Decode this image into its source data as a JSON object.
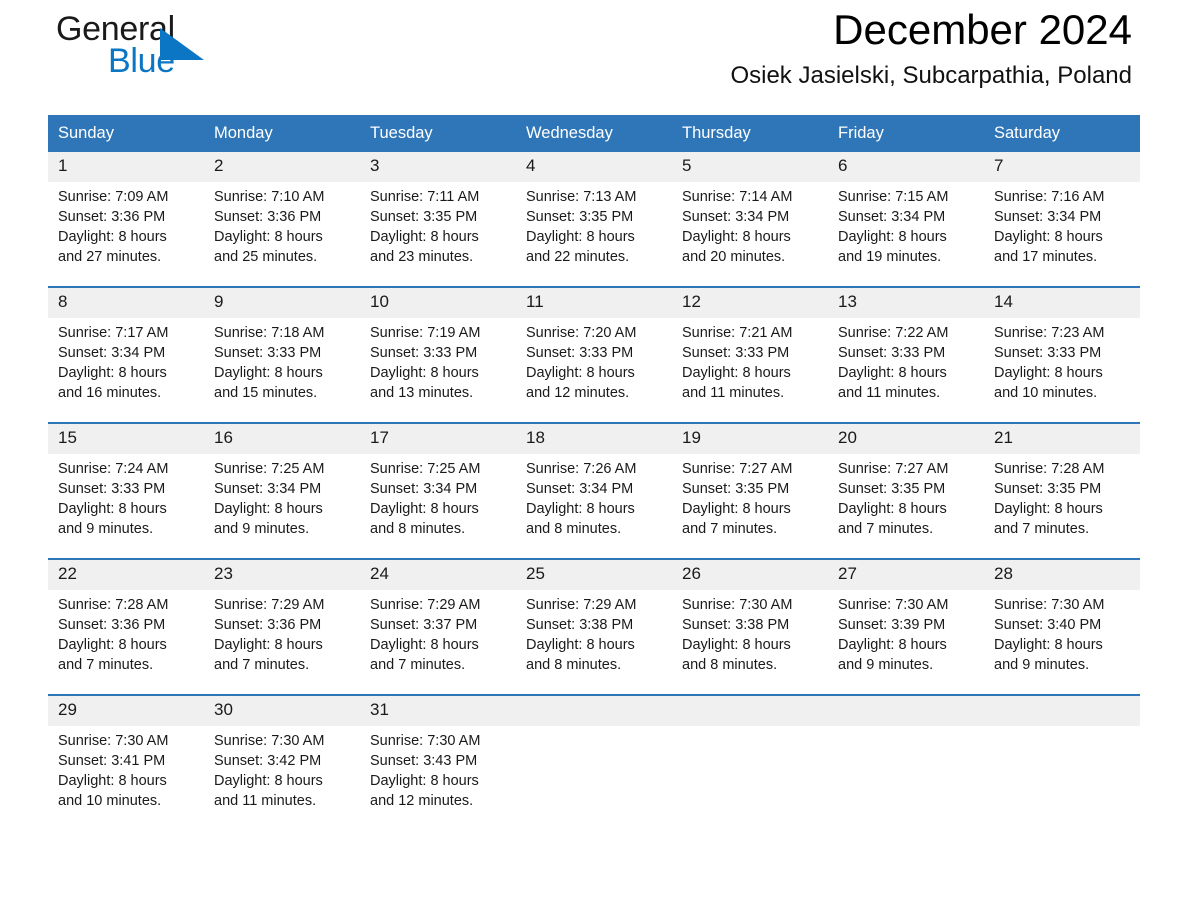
{
  "brand": {
    "name_part1": "General",
    "name_part2": "Blue",
    "flag_icon": "blue-triangle-flag-icon",
    "accent_color": "#0a76c4"
  },
  "header": {
    "title": "December 2024",
    "location": "Osiek Jasielski, Subcarpathia, Poland"
  },
  "theme": {
    "header_blue": "#2f76b8",
    "daynum_band": "#f0f0f0",
    "page_background": "#ffffff"
  },
  "calendar": {
    "weekday_headers": [
      "Sunday",
      "Monday",
      "Tuesday",
      "Wednesday",
      "Thursday",
      "Friday",
      "Saturday"
    ],
    "weeks": [
      [
        {
          "day": "1",
          "sunrise": "Sunrise: 7:09 AM",
          "sunset": "Sunset: 3:36 PM",
          "daylight1": "Daylight: 8 hours",
          "daylight2": "and 27 minutes."
        },
        {
          "day": "2",
          "sunrise": "Sunrise: 7:10 AM",
          "sunset": "Sunset: 3:36 PM",
          "daylight1": "Daylight: 8 hours",
          "daylight2": "and 25 minutes."
        },
        {
          "day": "3",
          "sunrise": "Sunrise: 7:11 AM",
          "sunset": "Sunset: 3:35 PM",
          "daylight1": "Daylight: 8 hours",
          "daylight2": "and 23 minutes."
        },
        {
          "day": "4",
          "sunrise": "Sunrise: 7:13 AM",
          "sunset": "Sunset: 3:35 PM",
          "daylight1": "Daylight: 8 hours",
          "daylight2": "and 22 minutes."
        },
        {
          "day": "5",
          "sunrise": "Sunrise: 7:14 AM",
          "sunset": "Sunset: 3:34 PM",
          "daylight1": "Daylight: 8 hours",
          "daylight2": "and 20 minutes."
        },
        {
          "day": "6",
          "sunrise": "Sunrise: 7:15 AM",
          "sunset": "Sunset: 3:34 PM",
          "daylight1": "Daylight: 8 hours",
          "daylight2": "and 19 minutes."
        },
        {
          "day": "7",
          "sunrise": "Sunrise: 7:16 AM",
          "sunset": "Sunset: 3:34 PM",
          "daylight1": "Daylight: 8 hours",
          "daylight2": "and 17 minutes."
        }
      ],
      [
        {
          "day": "8",
          "sunrise": "Sunrise: 7:17 AM",
          "sunset": "Sunset: 3:34 PM",
          "daylight1": "Daylight: 8 hours",
          "daylight2": "and 16 minutes."
        },
        {
          "day": "9",
          "sunrise": "Sunrise: 7:18 AM",
          "sunset": "Sunset: 3:33 PM",
          "daylight1": "Daylight: 8 hours",
          "daylight2": "and 15 minutes."
        },
        {
          "day": "10",
          "sunrise": "Sunrise: 7:19 AM",
          "sunset": "Sunset: 3:33 PM",
          "daylight1": "Daylight: 8 hours",
          "daylight2": "and 13 minutes."
        },
        {
          "day": "11",
          "sunrise": "Sunrise: 7:20 AM",
          "sunset": "Sunset: 3:33 PM",
          "daylight1": "Daylight: 8 hours",
          "daylight2": "and 12 minutes."
        },
        {
          "day": "12",
          "sunrise": "Sunrise: 7:21 AM",
          "sunset": "Sunset: 3:33 PM",
          "daylight1": "Daylight: 8 hours",
          "daylight2": "and 11 minutes."
        },
        {
          "day": "13",
          "sunrise": "Sunrise: 7:22 AM",
          "sunset": "Sunset: 3:33 PM",
          "daylight1": "Daylight: 8 hours",
          "daylight2": "and 11 minutes."
        },
        {
          "day": "14",
          "sunrise": "Sunrise: 7:23 AM",
          "sunset": "Sunset: 3:33 PM",
          "daylight1": "Daylight: 8 hours",
          "daylight2": "and 10 minutes."
        }
      ],
      [
        {
          "day": "15",
          "sunrise": "Sunrise: 7:24 AM",
          "sunset": "Sunset: 3:33 PM",
          "daylight1": "Daylight: 8 hours",
          "daylight2": "and 9 minutes."
        },
        {
          "day": "16",
          "sunrise": "Sunrise: 7:25 AM",
          "sunset": "Sunset: 3:34 PM",
          "daylight1": "Daylight: 8 hours",
          "daylight2": "and 9 minutes."
        },
        {
          "day": "17",
          "sunrise": "Sunrise: 7:25 AM",
          "sunset": "Sunset: 3:34 PM",
          "daylight1": "Daylight: 8 hours",
          "daylight2": "and 8 minutes."
        },
        {
          "day": "18",
          "sunrise": "Sunrise: 7:26 AM",
          "sunset": "Sunset: 3:34 PM",
          "daylight1": "Daylight: 8 hours",
          "daylight2": "and 8 minutes."
        },
        {
          "day": "19",
          "sunrise": "Sunrise: 7:27 AM",
          "sunset": "Sunset: 3:35 PM",
          "daylight1": "Daylight: 8 hours",
          "daylight2": "and 7 minutes."
        },
        {
          "day": "20",
          "sunrise": "Sunrise: 7:27 AM",
          "sunset": "Sunset: 3:35 PM",
          "daylight1": "Daylight: 8 hours",
          "daylight2": "and 7 minutes."
        },
        {
          "day": "21",
          "sunrise": "Sunrise: 7:28 AM",
          "sunset": "Sunset: 3:35 PM",
          "daylight1": "Daylight: 8 hours",
          "daylight2": "and 7 minutes."
        }
      ],
      [
        {
          "day": "22",
          "sunrise": "Sunrise: 7:28 AM",
          "sunset": "Sunset: 3:36 PM",
          "daylight1": "Daylight: 8 hours",
          "daylight2": "and 7 minutes."
        },
        {
          "day": "23",
          "sunrise": "Sunrise: 7:29 AM",
          "sunset": "Sunset: 3:36 PM",
          "daylight1": "Daylight: 8 hours",
          "daylight2": "and 7 minutes."
        },
        {
          "day": "24",
          "sunrise": "Sunrise: 7:29 AM",
          "sunset": "Sunset: 3:37 PM",
          "daylight1": "Daylight: 8 hours",
          "daylight2": "and 7 minutes."
        },
        {
          "day": "25",
          "sunrise": "Sunrise: 7:29 AM",
          "sunset": "Sunset: 3:38 PM",
          "daylight1": "Daylight: 8 hours",
          "daylight2": "and 8 minutes."
        },
        {
          "day": "26",
          "sunrise": "Sunrise: 7:30 AM",
          "sunset": "Sunset: 3:38 PM",
          "daylight1": "Daylight: 8 hours",
          "daylight2": "and 8 minutes."
        },
        {
          "day": "27",
          "sunrise": "Sunrise: 7:30 AM",
          "sunset": "Sunset: 3:39 PM",
          "daylight1": "Daylight: 8 hours",
          "daylight2": "and 9 minutes."
        },
        {
          "day": "28",
          "sunrise": "Sunrise: 7:30 AM",
          "sunset": "Sunset: 3:40 PM",
          "daylight1": "Daylight: 8 hours",
          "daylight2": "and 9 minutes."
        }
      ],
      [
        {
          "day": "29",
          "sunrise": "Sunrise: 7:30 AM",
          "sunset": "Sunset: 3:41 PM",
          "daylight1": "Daylight: 8 hours",
          "daylight2": "and 10 minutes."
        },
        {
          "day": "30",
          "sunrise": "Sunrise: 7:30 AM",
          "sunset": "Sunset: 3:42 PM",
          "daylight1": "Daylight: 8 hours",
          "daylight2": "and 11 minutes."
        },
        {
          "day": "31",
          "sunrise": "Sunrise: 7:30 AM",
          "sunset": "Sunset: 3:43 PM",
          "daylight1": "Daylight: 8 hours",
          "daylight2": "and 12 minutes."
        },
        {
          "day": "",
          "sunrise": "",
          "sunset": "",
          "daylight1": "",
          "daylight2": "",
          "empty": true
        },
        {
          "day": "",
          "sunrise": "",
          "sunset": "",
          "daylight1": "",
          "daylight2": "",
          "empty": true
        },
        {
          "day": "",
          "sunrise": "",
          "sunset": "",
          "daylight1": "",
          "daylight2": "",
          "empty": true
        },
        {
          "day": "",
          "sunrise": "",
          "sunset": "",
          "daylight1": "",
          "daylight2": "",
          "empty": true
        }
      ]
    ]
  }
}
